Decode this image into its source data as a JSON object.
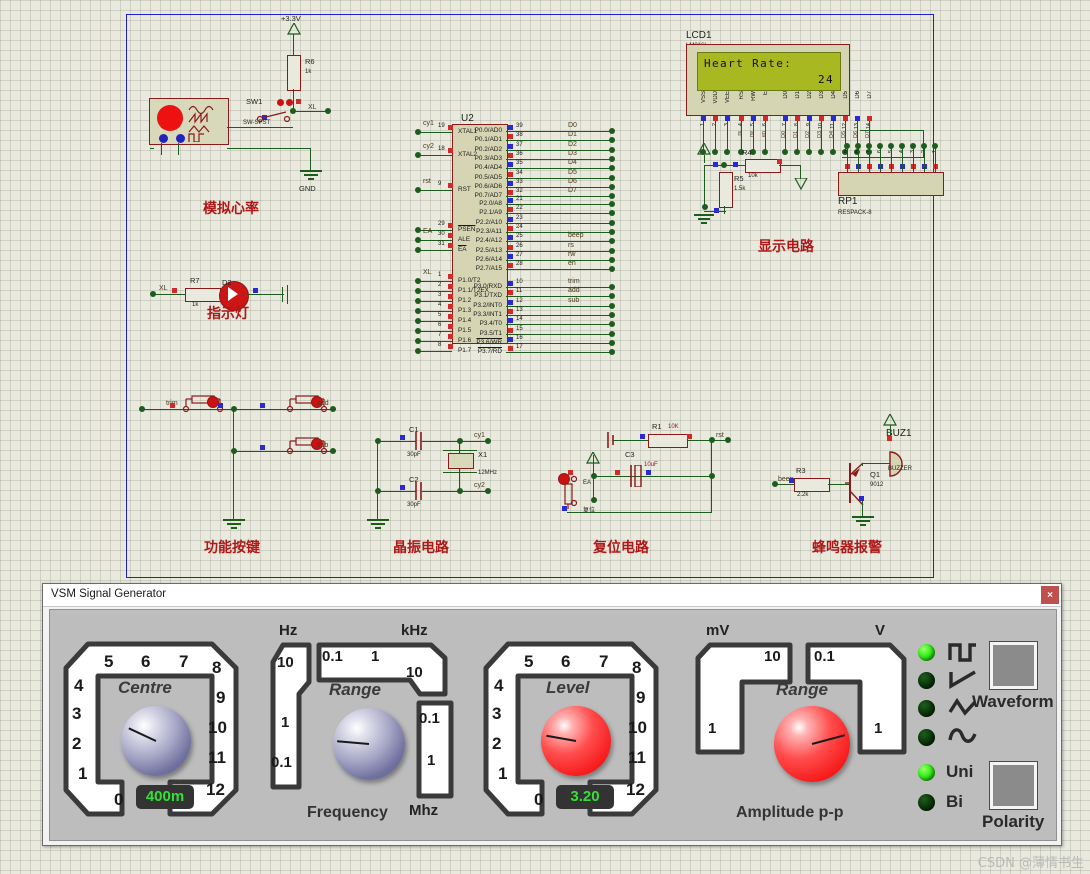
{
  "schematic": {
    "power": {
      "label": "+3.3V"
    },
    "section_labels": [
      {
        "id": "sim-heart-rate",
        "text": "模拟心率"
      },
      {
        "id": "indicator-lamp",
        "text": "指示灯"
      },
      {
        "id": "function-keys",
        "text": "功能按键"
      },
      {
        "id": "crystal-circuit",
        "text": "晶振电路"
      },
      {
        "id": "reset-circuit",
        "text": "复位电路"
      },
      {
        "id": "buzzer-alarm",
        "text": "蜂鸣器报警"
      },
      {
        "id": "display-circuit",
        "text": "显示电路"
      }
    ],
    "components": {
      "sw1": {
        "ref": "SW1",
        "value": "SW-SPST"
      },
      "r6": {
        "ref": "R6",
        "value": "1k"
      },
      "r7": {
        "ref": "R7",
        "value": "1k"
      },
      "d2": {
        "ref": "D2"
      },
      "c1": {
        "ref": "C1",
        "value": "30pF"
      },
      "c2": {
        "ref": "C2",
        "value": "30pF"
      },
      "x1": {
        "ref": "X1",
        "value": "12MHz"
      },
      "r1": {
        "ref": "R1",
        "value": "10K"
      },
      "c3": {
        "ref": "C3",
        "value": "10uF"
      },
      "r3": {
        "ref": "R3",
        "value": "2.2k"
      },
      "q1": {
        "ref": "Q1",
        "value": "9012"
      },
      "buz1": {
        "ref": "BUZ1",
        "value": "BUZZER"
      },
      "r4": {
        "ref": "R4",
        "value": "10k"
      },
      "r5": {
        "ref": "R5",
        "value": "1.5k"
      },
      "rp1": {
        "ref": "RP1",
        "value": "RESPACK-8"
      },
      "gnd": {
        "label": "GND"
      },
      "u2": {
        "ref": "U2"
      },
      "lcd1": {
        "ref": "LCD1",
        "value": "LM016L"
      }
    },
    "lcd": {
      "line1": "Heart Rate:",
      "line2": "24"
    },
    "u2_pins": {
      "left": [
        {
          "num": "19",
          "name": "XTAL1"
        },
        {
          "num": "18",
          "name": "XTAL2"
        },
        {
          "num": "9",
          "name": "RST"
        },
        {
          "num": "29",
          "name": "PSEN"
        },
        {
          "num": "30",
          "name": "ALE"
        },
        {
          "num": "31",
          "name": "EA"
        },
        {
          "num": "1",
          "name": "P1.0/T2"
        },
        {
          "num": "2",
          "name": "P1.1/T2EX"
        },
        {
          "num": "3",
          "name": "P1.2"
        },
        {
          "num": "4",
          "name": "P1.3"
        },
        {
          "num": "5",
          "name": "P1.4"
        },
        {
          "num": "6",
          "name": "P1.5"
        },
        {
          "num": "7",
          "name": "P1.6"
        },
        {
          "num": "8",
          "name": "P1.7"
        }
      ],
      "right_p0": [
        {
          "num": "39",
          "name": "P0.0/AD0",
          "net": "D0"
        },
        {
          "num": "38",
          "name": "P0.1/AD1",
          "net": "D1"
        },
        {
          "num": "37",
          "name": "P0.2/AD2",
          "net": "D2"
        },
        {
          "num": "36",
          "name": "P0.3/AD3",
          "net": "D3"
        },
        {
          "num": "35",
          "name": "P0.4/AD4",
          "net": "D4"
        },
        {
          "num": "34",
          "name": "P0.5/AD5",
          "net": "D5"
        },
        {
          "num": "33",
          "name": "P0.6/AD6",
          "net": "D6"
        },
        {
          "num": "32",
          "name": "P0.7/AD7",
          "net": "D7"
        }
      ],
      "right_p2": [
        {
          "num": "21",
          "name": "P2.0/A8",
          "net": ""
        },
        {
          "num": "22",
          "name": "P2.1/A9",
          "net": ""
        },
        {
          "num": "23",
          "name": "P2.2/A10",
          "net": ""
        },
        {
          "num": "24",
          "name": "P2.3/A11",
          "net": ""
        },
        {
          "num": "25",
          "name": "P2.4/A12",
          "net": "beep"
        },
        {
          "num": "26",
          "name": "P2.5/A13",
          "net": "rs"
        },
        {
          "num": "27",
          "name": "P2.6/A14",
          "net": "rw"
        },
        {
          "num": "28",
          "name": "P2.7/A15",
          "net": "en"
        }
      ],
      "right_p3": [
        {
          "num": "10",
          "name": "P3.0/RXD",
          "net": "trim"
        },
        {
          "num": "11",
          "name": "P3.1/TXD",
          "net": "add"
        },
        {
          "num": "12",
          "name": "P3.2/INT0",
          "net": "sub"
        },
        {
          "num": "13",
          "name": "P3.3/INT1",
          "net": ""
        },
        {
          "num": "14",
          "name": "P3.4/T0",
          "net": ""
        },
        {
          "num": "15",
          "name": "P3.5/T1",
          "net": ""
        },
        {
          "num": "16",
          "name": "P3.6/WR",
          "net": ""
        },
        {
          "num": "17",
          "name": "P3.7/RD",
          "net": ""
        }
      ]
    },
    "nets": {
      "cy1": "cy1",
      "cy2": "cy2",
      "rst": "rst",
      "ea": "EA",
      "xl": "XL",
      "trim": "trim",
      "add": "add",
      "sub": "sub",
      "beep": "beep",
      "reset_cn": "复位"
    },
    "lcd_pins_top": [
      "VSS",
      "VDD",
      "VEE",
      "RS",
      "RW",
      "E",
      "D0",
      "D1",
      "D2",
      "D3",
      "D4",
      "D5",
      "D6",
      "D7"
    ],
    "lcd_pin_nums": [
      "1",
      "2",
      "3",
      "4",
      "5",
      "6",
      "7",
      "8",
      "9",
      "10",
      "11",
      "12",
      "13",
      "14"
    ],
    "lcd_pin_nets": [
      "",
      "",
      "",
      "rs",
      "rw",
      "en",
      "D0",
      "D1",
      "D2",
      "D3",
      "D4",
      "D5",
      "D6",
      "D7"
    ],
    "rp1_pins": [
      "9",
      "8",
      "7",
      "6",
      "5",
      "4",
      "3",
      "2",
      "1"
    ]
  },
  "vsm": {
    "title": "VSM Signal Generator",
    "close_label": "×",
    "frequency": {
      "group_label": "Frequency",
      "centre": {
        "caption": "Centre",
        "readout": "400m",
        "knob_color": "#7272a0",
        "scale": [
          "0",
          "1",
          "2",
          "3",
          "4",
          "5",
          "6",
          "7",
          "8",
          "9",
          "10",
          "11",
          "12"
        ],
        "pointer_deg": 205
      },
      "range": {
        "caption": "Range",
        "knob_color": "#7272a0",
        "unit_left": "Hz",
        "unit_top_right": "kHz",
        "unit_bottom_right": "Mhz",
        "left_scale": [
          "10",
          "1",
          "0.1"
        ],
        "top_scale": [
          "0.1",
          "1",
          "10"
        ],
        "right_scale": [
          "0.1",
          "1"
        ],
        "pointer_deg": 185
      }
    },
    "amplitude": {
      "group_label": "Amplitude p-p",
      "level": {
        "caption": "Level",
        "readout": "3.20",
        "knob_color": "#ff3b30",
        "scale": [
          "0",
          "1",
          "2",
          "3",
          "4",
          "5",
          "6",
          "7",
          "8",
          "9",
          "10",
          "11",
          "12"
        ],
        "pointer_deg": 190
      },
      "range": {
        "caption": "Range",
        "knob_color": "#ff3b30",
        "unit_left": "mV",
        "unit_right": "V",
        "left_scale": [
          "10",
          "1"
        ],
        "right_scale": [
          "0.1",
          "1"
        ],
        "pointer_deg": 345
      }
    },
    "waveform": {
      "button_label": "Waveform",
      "options": [
        {
          "icon": "square-wave-icon",
          "state": "on"
        },
        {
          "icon": "sawtooth-wave-icon",
          "state": "off"
        },
        {
          "icon": "triangle-wave-icon",
          "state": "off"
        },
        {
          "icon": "sine-wave-icon",
          "state": "off"
        }
      ]
    },
    "polarity": {
      "button_label": "Polarity",
      "options": [
        {
          "label": "Uni",
          "state": "on"
        },
        {
          "label": "Bi",
          "state": "off"
        }
      ]
    }
  },
  "watermark": {
    "text": "CSDN @薄情书生"
  }
}
